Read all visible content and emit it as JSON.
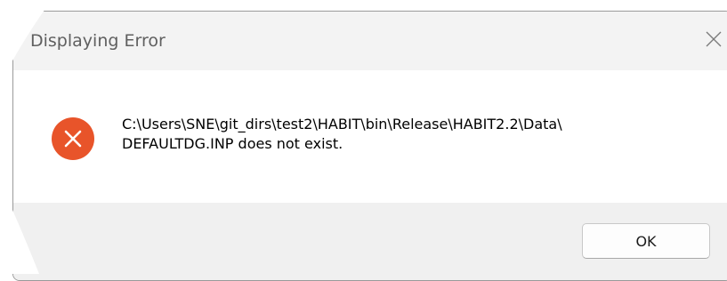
{
  "dialog": {
    "title": "Displaying Error",
    "message_line1": "C:\\Users\\SNE\\git_dirs\\test2\\HABIT\\bin\\Release\\HABIT2.2\\Data\\",
    "message_line2": "DEFAULTDG.INP does not exist.",
    "ok_label": "OK",
    "icon": "error-icon",
    "close_icon": "close-icon"
  },
  "colors": {
    "error_icon": "#e8542a",
    "titlebar_bg": "#f3f3f3",
    "footer_bg": "#f0f0f0"
  }
}
